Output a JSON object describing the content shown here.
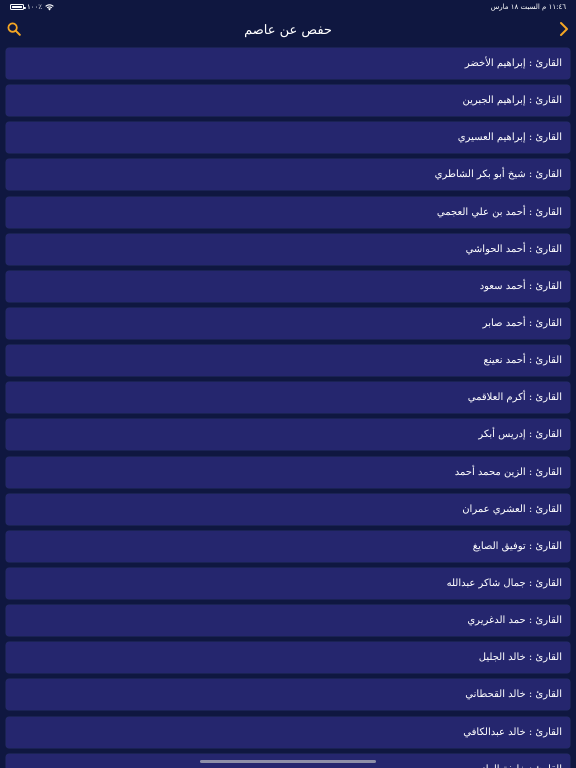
{
  "status_bar": {
    "battery": "١٠٠٪",
    "datetime": "١١:٤٦ م   السبت ١٨ مارس",
    "battery_level": 1.0
  },
  "nav": {
    "title": "حفص عن عاصم",
    "search_icon": "search-icon",
    "back_icon": "chevron-right-icon",
    "accent": "#f5a623"
  },
  "colors": {
    "background": "#0f1740",
    "row": "#25266e",
    "text": "#ffffff"
  },
  "reciters": [
    "القارئ : إبراهيم الأخضر",
    "القارئ : إبراهيم الجبرين",
    "القارئ : إبراهيم العسيري",
    "القارئ : شيخ أبو بكر الشاطري",
    "القارئ : أحمد بن علي العجمي",
    "القارئ : أحمد الحواشي",
    "القارئ : أحمد سعود",
    "القارئ : أحمد صابر",
    "القارئ : أحمد نعينع",
    "القارئ : أكرم العلاقمي",
    "القارئ : إدريس أبكر",
    "القارئ : الزين محمد أحمد",
    "القارئ : العشري عمران",
    "القارئ : توفيق الصايغ",
    "القارئ : جمال شاكر عبدالله",
    "القارئ : حمد الدغريري",
    "القارئ : خالد الجليل",
    "القارئ : خالد القحطاني",
    "القارئ : خالد عبدالكافي",
    "القارئ : خليفة الطنيجي"
  ]
}
